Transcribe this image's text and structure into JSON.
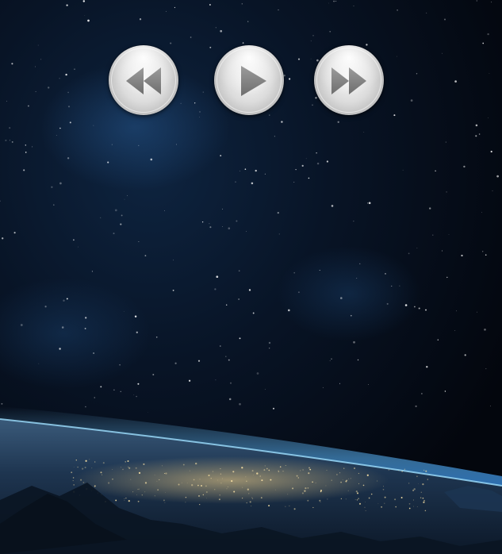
{
  "media_controls": {
    "buttons": [
      {
        "action": "rewind",
        "icon": "rewind-icon"
      },
      {
        "action": "play",
        "icon": "play-icon"
      },
      {
        "action": "fast-forward",
        "icon": "fast-forward-icon"
      }
    ]
  },
  "colors": {
    "space": "#04070f",
    "atmosphere_glow": "#4aa8ff",
    "button_face": "#dcdcdc",
    "icon_fill": "#8a8a8a"
  }
}
